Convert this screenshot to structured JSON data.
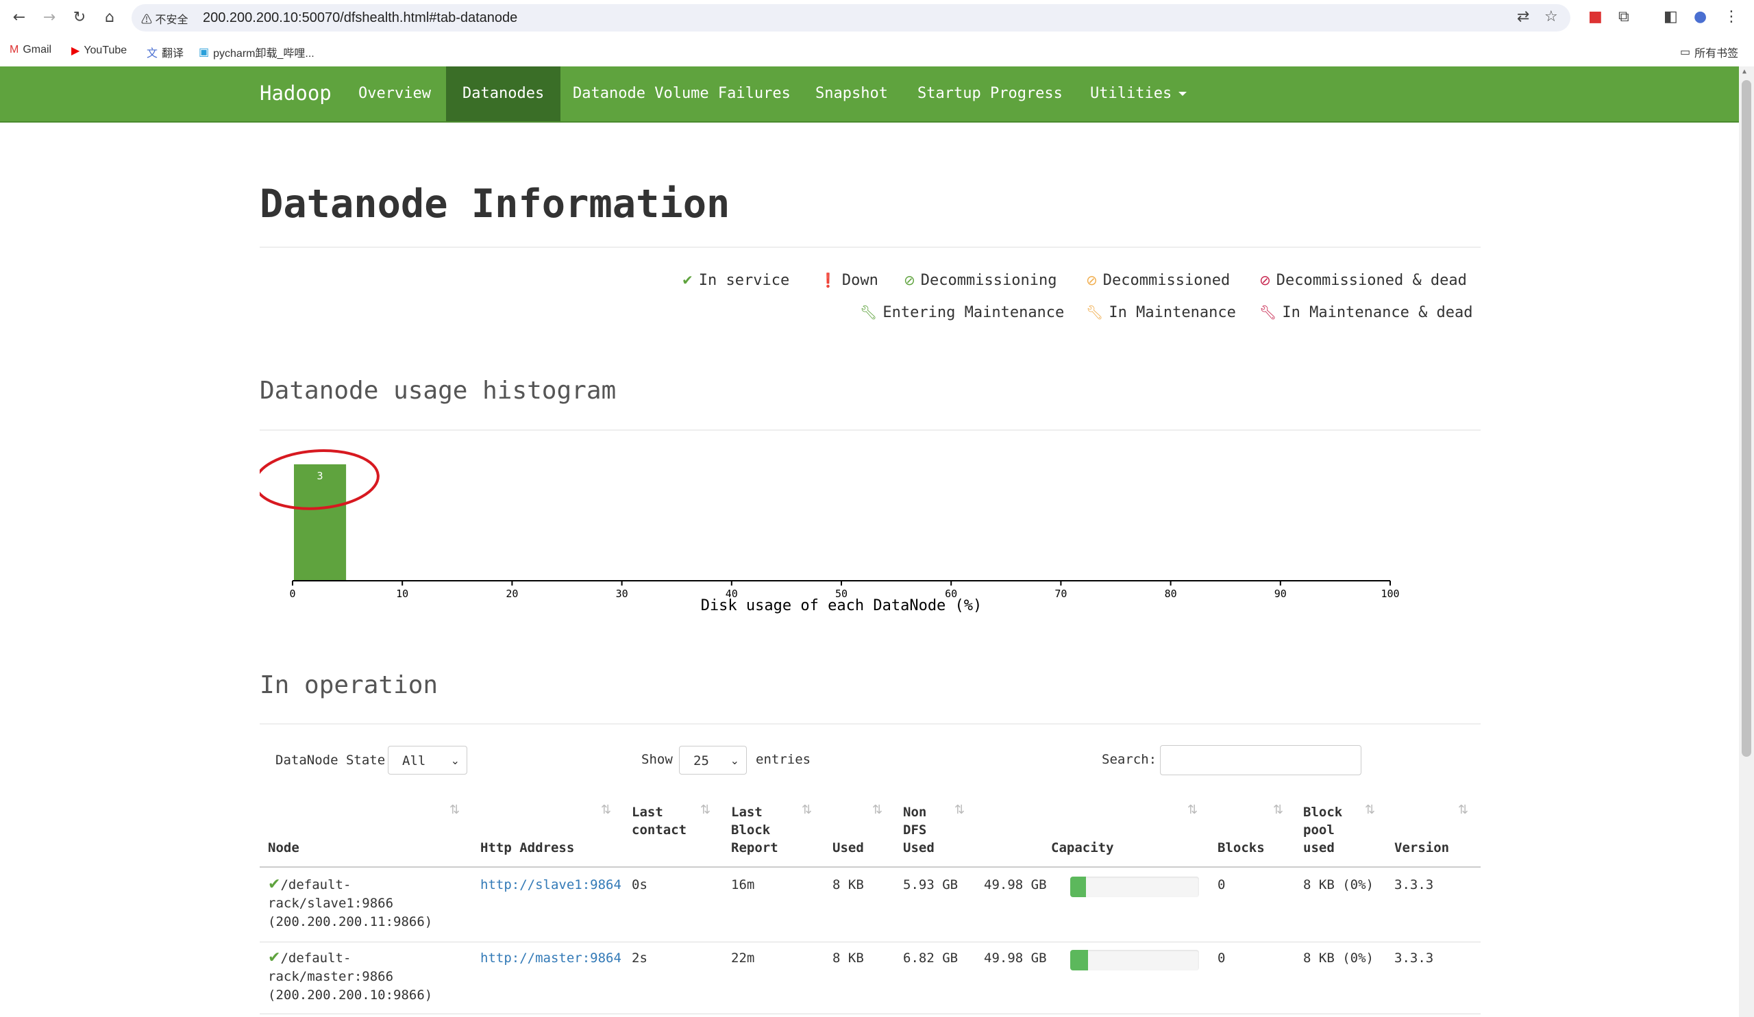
{
  "browser": {
    "security_label": "⚠ 不安全",
    "url": "200.200.200.10:50070/dfshealth.html#tab-datanode",
    "bookmarks": [
      "Gmail",
      "YouTube",
      "翻译",
      "pycharm卸载_哔哩...",
      "所有书签"
    ]
  },
  "navbar": {
    "brand": "Hadoop",
    "items": [
      "Overview",
      "Datanodes",
      "Datanode Volume Failures",
      "Snapshot",
      "Startup Progress",
      "Utilities"
    ],
    "active": "Datanodes",
    "color": "#5fa33e"
  },
  "page": {
    "title": "Datanode Information",
    "legend": [
      {
        "icon": "check-icon",
        "label": "In service",
        "color": "#5fa33e"
      },
      {
        "icon": "exclamation-circle-icon",
        "label": "Down",
        "color": "#c7254e"
      },
      {
        "icon": "ban-icon",
        "label": "Decommissioning",
        "color": "#5fa33e"
      },
      {
        "icon": "ban-icon",
        "label": "Decommissioned",
        "color": "#f0ad4e"
      },
      {
        "icon": "ban-icon",
        "label": "Decommissioned & dead",
        "color": "#c7254e"
      },
      {
        "icon": "wrench-icon",
        "label": "Entering Maintenance",
        "color": "#5fa33e"
      },
      {
        "icon": "wrench-icon",
        "label": "In Maintenance",
        "color": "#f0ad4e"
      },
      {
        "icon": "wrench-icon",
        "label": "In Maintenance & dead",
        "color": "#c7254e"
      }
    ],
    "histogram_heading": "Datanode usage histogram",
    "operation_heading": "In operation"
  },
  "chart_data": {
    "type": "bar",
    "bins": [
      [
        0,
        5
      ]
    ],
    "values": [
      3
    ],
    "xlabel": "Disk usage of each DataNode (%)",
    "xlim": [
      0,
      100
    ],
    "xticks": [
      0,
      10,
      20,
      30,
      40,
      50,
      60,
      70,
      80,
      90,
      100
    ],
    "bar_color": "#5fa33e",
    "annotation": "red hand-drawn circle around the bar"
  },
  "controls": {
    "state_label": "DataNode State",
    "state_value": "All",
    "show_label": "Show",
    "show_value": "25",
    "entries_label": "entries",
    "search_label": "Search:",
    "search_value": ""
  },
  "table": {
    "headers": [
      "Node",
      "Http Address",
      "Last contact",
      "Last Block Report",
      "Used",
      "Non DFS Used",
      "Capacity",
      "Blocks",
      "Block pool used",
      "Version"
    ],
    "rows": [
      {
        "node_lines": [
          "/default-",
          "rack/slave1:9866",
          "(200.200.200.11:9866)"
        ],
        "http": "http://slave1:9864",
        "last_contact": "0s",
        "last_block_report": "16m",
        "used": "8 KB",
        "non_dfs": "5.93 GB",
        "capacity": "49.98 GB",
        "capacity_fraction": 0.12,
        "blocks": "0",
        "block_pool_used": "8 KB (0%)",
        "version": "3.3.3"
      },
      {
        "node_lines": [
          "/default-",
          "rack/master:9866",
          "(200.200.200.10:9866)"
        ],
        "http": "http://master:9864",
        "last_contact": "2s",
        "last_block_report": "22m",
        "used": "8 KB",
        "non_dfs": "6.82 GB",
        "capacity": "49.98 GB",
        "capacity_fraction": 0.14,
        "blocks": "0",
        "block_pool_used": "8 KB (0%)",
        "version": "3.3.3"
      }
    ]
  }
}
